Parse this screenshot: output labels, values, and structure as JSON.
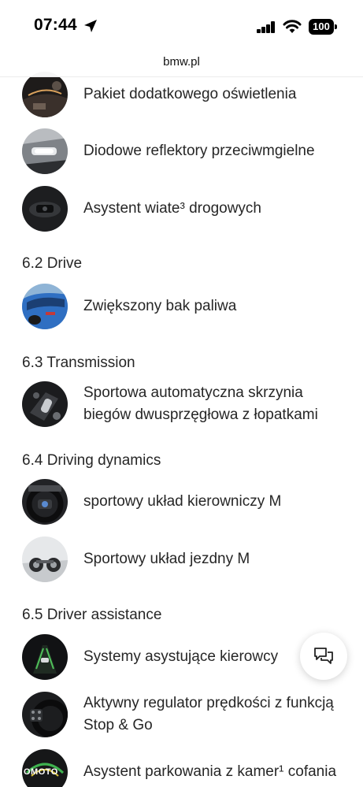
{
  "status_bar": {
    "time": "07:44",
    "battery": "100"
  },
  "browser": {
    "url": "bmw.pl"
  },
  "items_top": [
    {
      "label": "Pakiet dodatkowego oświetlenia",
      "icon": "interior-lighting-image"
    },
    {
      "label": "Diodowe reflektory przeciwmgielne",
      "icon": "fog-light-image"
    },
    {
      "label": "Asystent wiate³ drogowych",
      "icon": "high-beam-assistant-image"
    }
  ],
  "sections": [
    {
      "title": "6.2 Drive",
      "items": [
        {
          "label": "Zwiększony bak paliwa",
          "icon": "blue-car-image"
        }
      ]
    },
    {
      "title": "6.3 Transmission",
      "items": [
        {
          "label_lines": [
            "Sportowa automatyczna skrzynia",
            "biegów dwusprzęgłowa z łopatkami"
          ],
          "icon": "gear-selector-image"
        }
      ]
    },
    {
      "title": "6.4 Driving dynamics",
      "items": [
        {
          "label": "sportowy układ kierowniczy M",
          "icon": "steering-wheel-image"
        },
        {
          "label": "Sportowy układ jezdny M",
          "icon": "suspension-image"
        }
      ]
    },
    {
      "title": "6.5 Driver assistance",
      "items": [
        {
          "label": "Systemy asystujące kierowcy",
          "icon": "driver-assist-image"
        },
        {
          "label_lines": [
            "Aktywny regulator prędkości z funkcją",
            "Stop & Go"
          ],
          "icon": "cruise-control-image"
        },
        {
          "label": "Asystent parkowania z kamer¹ cofania",
          "icon": "parking-camera-image"
        }
      ]
    }
  ],
  "watermark": "OMOTO",
  "chat_icon": "chat-bubbles-icon",
  "colors": {
    "text": "#262626",
    "background": "#ffffff",
    "car_blue": "#2f6fc2"
  }
}
